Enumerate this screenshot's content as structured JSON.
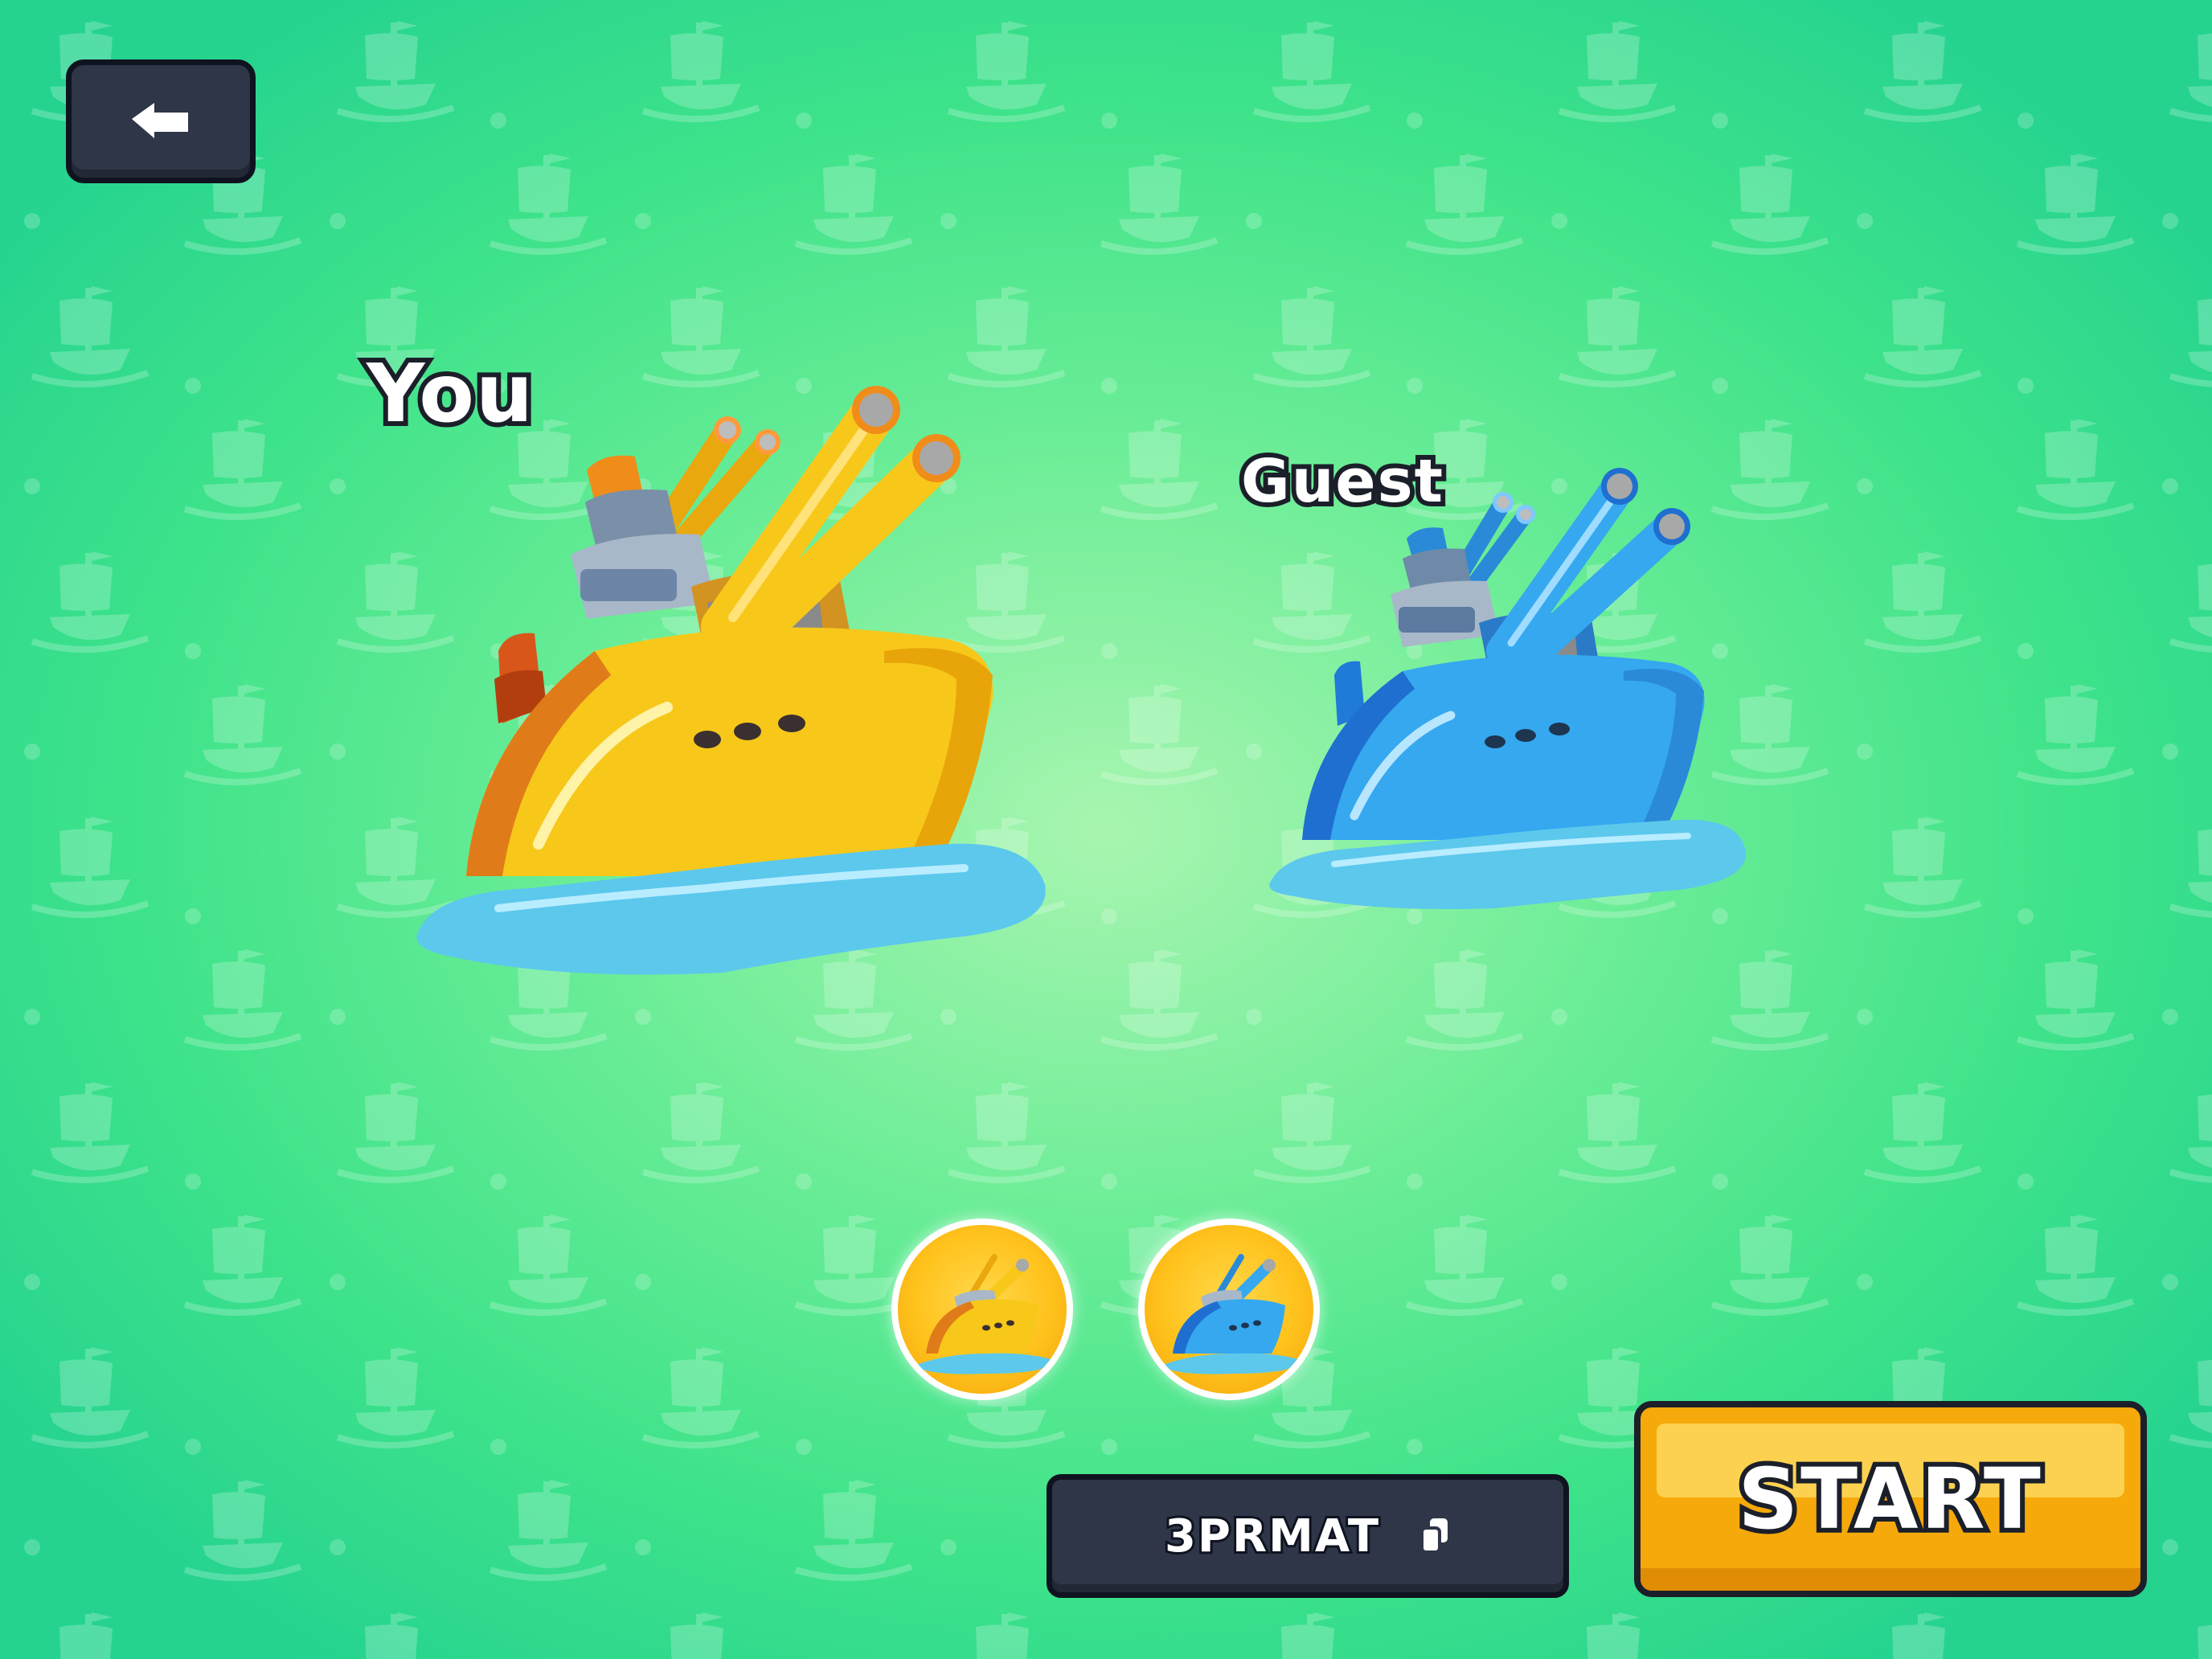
{
  "screen": "room-lobby",
  "background": {
    "colors": [
      "#a8f5b0",
      "#3fe38a",
      "#25d38f"
    ],
    "pattern_icon": "pirate-ship-icon"
  },
  "back_button": {
    "icon": "back-arrow-icon"
  },
  "players": [
    {
      "label": "You",
      "ship_color": "yellow"
    },
    {
      "label": "Guest",
      "ship_color": "blue"
    }
  ],
  "ship_selectors": [
    {
      "color": "yellow",
      "icon": "yellow-ship-icon"
    },
    {
      "color": "blue",
      "icon": "blue-ship-icon"
    }
  ],
  "room_code": {
    "value": "3PRMAT",
    "icon": "copy-icon"
  },
  "start_button": {
    "label": "START",
    "color": "#f5a90a"
  },
  "colors": {
    "dark_button": "#2e3648",
    "accent_yellow": "#ffc21c",
    "ship_yellow": "#f7c81a",
    "ship_blue": "#35a8f0",
    "water": "#5cc8ec"
  }
}
